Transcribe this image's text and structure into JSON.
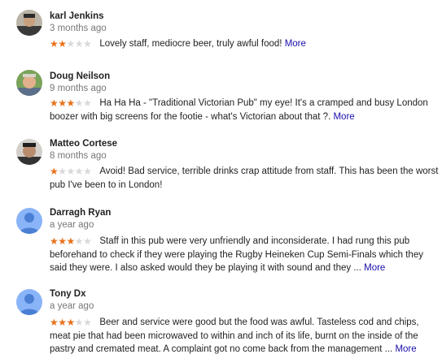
{
  "colors": {
    "star_filled": "#e7711b",
    "star_empty": "#d8d8d8",
    "link": "#1a0dab",
    "default_avatar": "#8ab4f8"
  },
  "reviews": [
    {
      "author": "karl Jenkins",
      "time": "3 months ago",
      "rating": 2,
      "text": "Lovely staff, mediocre beer, truly awful food!",
      "more": "More",
      "avatar": "photo-avatar"
    },
    {
      "author": "Doug Neilson",
      "time": "9 months ago",
      "rating": 3,
      "text": "Ha Ha Ha - \"Traditional Victorian Pub\" my eye! It's a cramped and busy London boozer with big screens for the footie - what's Victorian about that ?.",
      "more": "More",
      "avatar": "photo-avatar"
    },
    {
      "author": "Matteo Cortese",
      "time": "8 months ago",
      "rating": 1,
      "text": "Avoid! Bad service, terrible drinks crap attitude from staff. This has been the worst pub I've been to in London!",
      "more": "",
      "avatar": "photo-avatar"
    },
    {
      "author": "Darragh Ryan",
      "time": "a year ago",
      "rating": 3,
      "text": "Staff in this pub were very unfriendly and inconsiderate. I had rung this pub beforehand to check if they were playing the Rugby Heineken Cup Semi-Finals which they said they were. I also asked would they be playing it with sound and they ...",
      "more": "More",
      "avatar": "default-user-icon"
    },
    {
      "author": "Tony Dx",
      "time": "a year ago",
      "rating": 3,
      "text": "Beer and service were good but the food was awful. Tasteless cod and chips, meat pie that had been microwaved to within and inch of its life, burnt on the inside of the pastry and cremated meat. A complaint got no come back from the management ...",
      "more": "More",
      "avatar": "default-user-icon"
    }
  ]
}
